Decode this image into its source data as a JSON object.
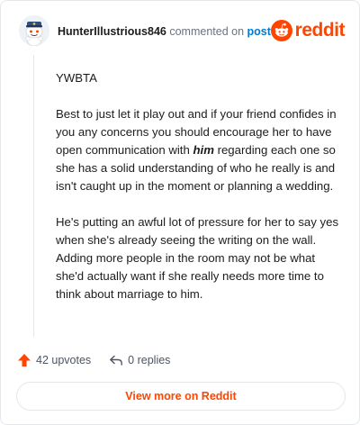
{
  "header": {
    "username": "HunterIllustrious846",
    "action_text": "commented on",
    "post_link": "post",
    "brand": "reddit"
  },
  "comment": {
    "paragraphs": [
      {
        "parts": [
          {
            "text": "YWBTA"
          }
        ]
      },
      {
        "parts": [
          {
            "text": "Best to just let it play out and if your friend confides in you any concerns you should encourage her to have open communication with "
          },
          {
            "text": "him",
            "emphasis": true
          },
          {
            "text": " regarding each one so she has a solid understanding of who he really is and isn't caught up in the moment or planning a wedding."
          }
        ]
      },
      {
        "parts": [
          {
            "text": "He's putting an awful lot of pressure for her to say yes when she's already seeing the writing on the wall. Adding more people in the room may not be what she'd actually want if she really needs more time to think about marriage to him."
          }
        ]
      }
    ]
  },
  "actions": {
    "upvotes": "42 upvotes",
    "replies": "0 replies"
  },
  "footer": {
    "view_more": "View more on Reddit"
  },
  "colors": {
    "brand": "#ff4500",
    "link": "#0079d3",
    "muted": "#6b7280"
  }
}
